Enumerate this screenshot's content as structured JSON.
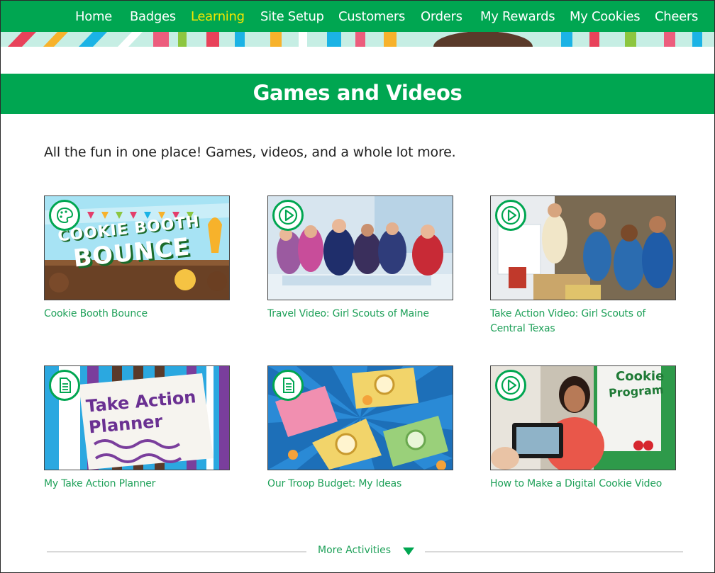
{
  "nav": {
    "items": [
      {
        "label": "Home"
      },
      {
        "label": "Badges"
      },
      {
        "label": "Learning",
        "active": true
      },
      {
        "label": "Site Setup"
      },
      {
        "label": "Customers"
      },
      {
        "label": "Orders"
      },
      {
        "label": "My Rewards"
      },
      {
        "label": "My Cookies"
      },
      {
        "label": "Cheers"
      }
    ]
  },
  "page": {
    "title": "Games and Videos",
    "intro": "All the fun in one place! Games, videos, and a whole lot more."
  },
  "cards": [
    {
      "caption": "Cookie Booth Bounce",
      "badge_icon": "game-palette-icon",
      "thumb_text_1": "COOKIE BOOTH",
      "thumb_text_2": "BOUNCE"
    },
    {
      "caption": "Travel Video: Girl Scouts of Maine",
      "badge_icon": "play-icon"
    },
    {
      "caption": "Take Action Video: Girl Scouts of Central Texas",
      "badge_icon": "play-icon"
    },
    {
      "caption": "My Take Action Planner",
      "badge_icon": "document-icon",
      "thumb_text_1": "Take Action",
      "thumb_text_2": "Planner"
    },
    {
      "caption": "Our Troop Budget: My Ideas",
      "badge_icon": "document-icon"
    },
    {
      "caption": "How to Make a Digital Cookie Video",
      "badge_icon": "play-icon",
      "thumb_text_1": "Cookie",
      "thumb_text_2": "Program"
    }
  ],
  "more": {
    "label": "More Activities",
    "icon": "triangle-down-icon"
  },
  "colors": {
    "brand_green": "#00a651",
    "active_nav": "#f3e600",
    "link_green": "#20a15a"
  }
}
